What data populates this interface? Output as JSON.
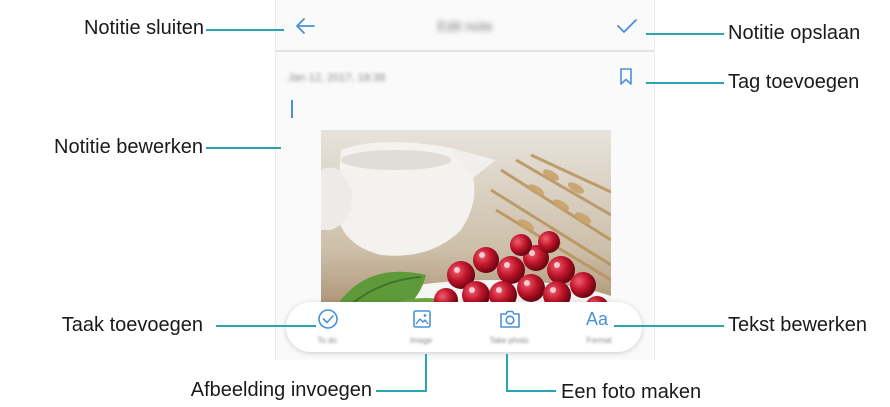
{
  "app": {
    "title": "Edit note",
    "date": "Jan 12, 2017, 18:38"
  },
  "toolbar": {
    "items": [
      {
        "icon": "check-circle-icon",
        "label": "To do"
      },
      {
        "icon": "image-icon",
        "label": "Image"
      },
      {
        "icon": "camera-icon",
        "label": "Take photo"
      },
      {
        "icon": "format-text-icon",
        "glyph": "Aa",
        "label": "Format"
      }
    ]
  },
  "callouts": {
    "close": "Notitie sluiten",
    "save": "Notitie opslaan",
    "tag": "Tag toevoegen",
    "edit": "Notitie bewerken",
    "todo": "Taak toevoegen",
    "format": "Tekst bewerken",
    "insert_image": "Afbeelding invoegen",
    "take_photo": "Een foto maken"
  },
  "colors": {
    "accent": "#4a90d9",
    "callout_line": "#2aa4ae"
  }
}
